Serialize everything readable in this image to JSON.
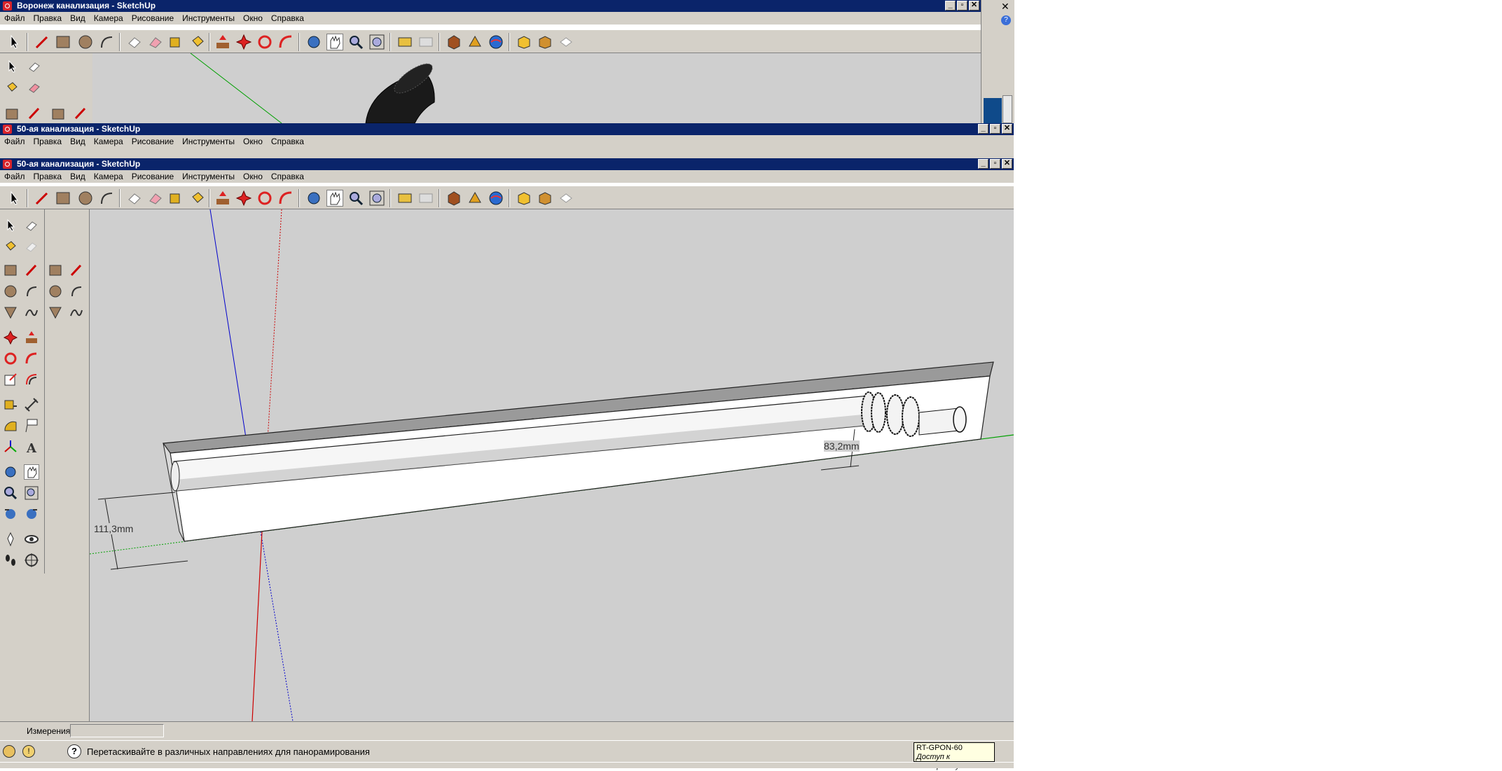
{
  "windows": [
    {
      "title": "Воронеж канализация - SketchUp"
    },
    {
      "title": "50-ая канализация - SketchUp"
    },
    {
      "title": "50-ая канализация - SketchUp"
    }
  ],
  "menu": [
    "Файл",
    "Правка",
    "Вид",
    "Камера",
    "Рисование",
    "Инструменты",
    "Окно",
    "Справка"
  ],
  "window_buttons": {
    "minimize": "_",
    "restore": "▫",
    "close": "✕"
  },
  "dimensions": {
    "left": "111,3mm",
    "right": "83,2mm"
  },
  "measurements": {
    "label": "Измерения",
    "value": ""
  },
  "status_hint": "Перетаскивайте в различных направлениях для панорамирования",
  "tooltip": {
    "line1": "RT-GPON-60",
    "line2": "Доступ к Интернету"
  },
  "colors": {
    "titlebar": "#0a246a",
    "chrome": "#d4d0c8",
    "viewport_bg": "#cfcfcf",
    "axis_red": "#cc0000",
    "axis_green": "#00a000",
    "axis_blue": "#0000cc"
  }
}
